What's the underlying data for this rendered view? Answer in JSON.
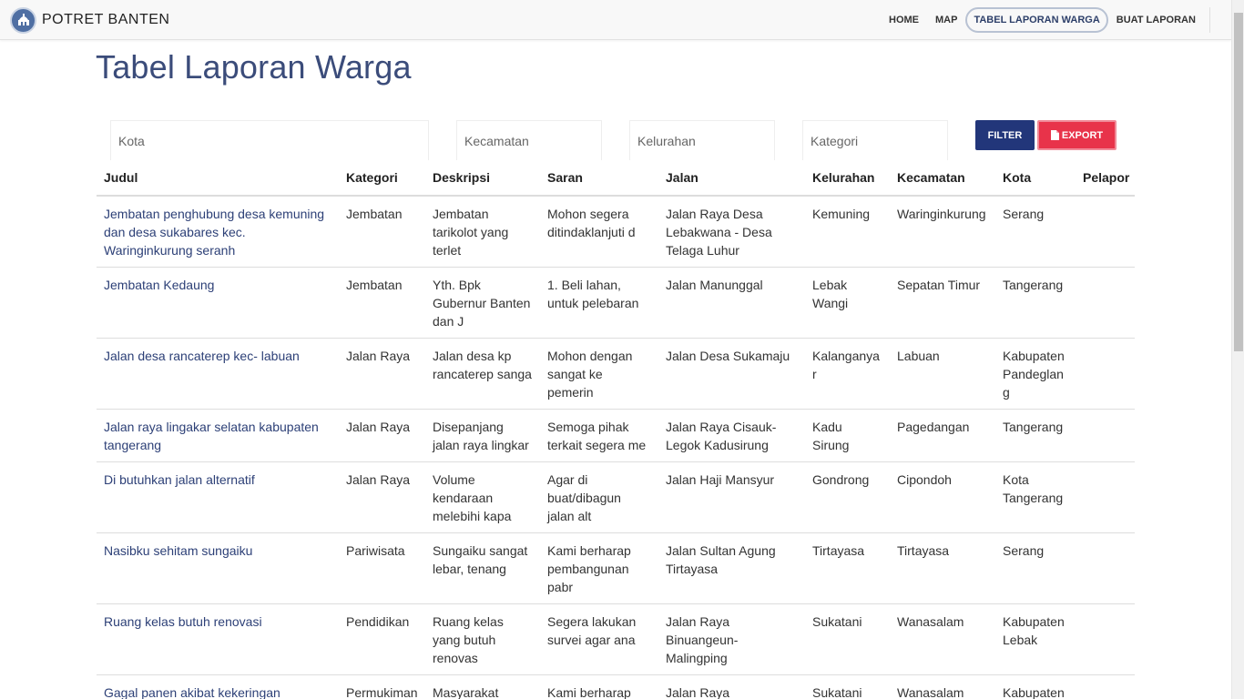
{
  "brand": {
    "name": "POTRET BANTEN"
  },
  "nav": [
    {
      "label": "HOME",
      "active": false
    },
    {
      "label": "MAP",
      "active": false
    },
    {
      "label": "TABEL LAPORAN WARGA",
      "active": true
    },
    {
      "label": "BUAT LAPORAN",
      "active": false
    }
  ],
  "page": {
    "title": "Tabel Laporan Warga"
  },
  "filters": {
    "kota_placeholder": "Kota",
    "kecamatan_placeholder": "Kecamatan",
    "kelurahan_placeholder": "Kelurahan",
    "kategori_placeholder": "Kategori",
    "filter_label": "FILTER",
    "export_label": "EXPORT"
  },
  "table": {
    "headers": [
      "Judul",
      "Kategori",
      "Deskripsi",
      "Saran",
      "Jalan",
      "Kelurahan",
      "Kecamatan",
      "Kota",
      "Pelapor"
    ],
    "rows": [
      [
        "Jembatan penghubung desa kemuning dan desa sukabares kec. Waringinkurung seranh",
        "Jembatan",
        "Jembatan tarikolot yang terlet",
        "Mohon segera ditindaklanjuti d",
        "Jalan Raya Desa Lebakwana - Desa Telaga Luhur",
        "Kemuning",
        "Waringinkurung",
        "Serang",
        ""
      ],
      [
        "Jembatan Kedaung",
        "Jembatan",
        "Yth. Bpk Gubernur Banten dan J",
        "1. Beli lahan, untuk pelebaran",
        "Jalan Manunggal",
        "Lebak Wangi",
        "Sepatan Timur",
        "Tangerang",
        ""
      ],
      [
        "Jalan desa rancaterep kec- labuan",
        "Jalan Raya",
        "Jalan desa kp rancaterep sanga",
        "Mohon dengan sangat ke pemerin",
        "Jalan Desa Sukamaju",
        "Kalanganyar",
        "Labuan",
        "Kabupaten Pandeglang",
        ""
      ],
      [
        "Jalan raya lingakar selatan kabupaten tangerang",
        "Jalan Raya",
        "Disepanjang jalan raya lingkar",
        "Semoga pihak terkait segera me",
        "Jalan Raya Cisauk-Legok Kadusirung",
        "Kadu Sirung",
        "Pagedangan",
        "Tangerang",
        ""
      ],
      [
        "Di butuhkan jalan alternatif",
        "Jalan Raya",
        "Volume kendaraan melebihi kapa",
        "Agar di buat/dibagun jalan alt",
        "Jalan Haji Mansyur",
        "Gondrong",
        "Cipondoh",
        "Kota Tangerang",
        ""
      ],
      [
        "Nasibku sehitam sungaiku",
        "Pariwisata",
        "Sungaiku sangat lebar, tenang",
        "Kami berharap pembangunan pabr",
        "Jalan Sultan Agung Tirtayasa",
        "Tirtayasa",
        "Tirtayasa",
        "Serang",
        ""
      ],
      [
        "Ruang kelas butuh renovasi",
        "Pendidikan",
        "Ruang kelas yang butuh renovas",
        "Segera lakukan survei agar ana",
        "Jalan Raya Binuangeun-Malingping",
        "Sukatani",
        "Wanasalam",
        "Kabupaten Lebak",
        ""
      ],
      [
        "Gagal panen akibat kekeringan",
        "Permukiman dan Lahan",
        "Masyarakat Wanasalam",
        "Kami berharap agar pemerintah",
        "Jalan Raya Binuangeun-",
        "Sukatani",
        "Wanasalam",
        "Kabupaten Lebak",
        ""
      ]
    ]
  },
  "colors": {
    "accent": "#22367a",
    "export": "#e8334a",
    "title": "#3b4c7a",
    "link": "#2d4077"
  }
}
